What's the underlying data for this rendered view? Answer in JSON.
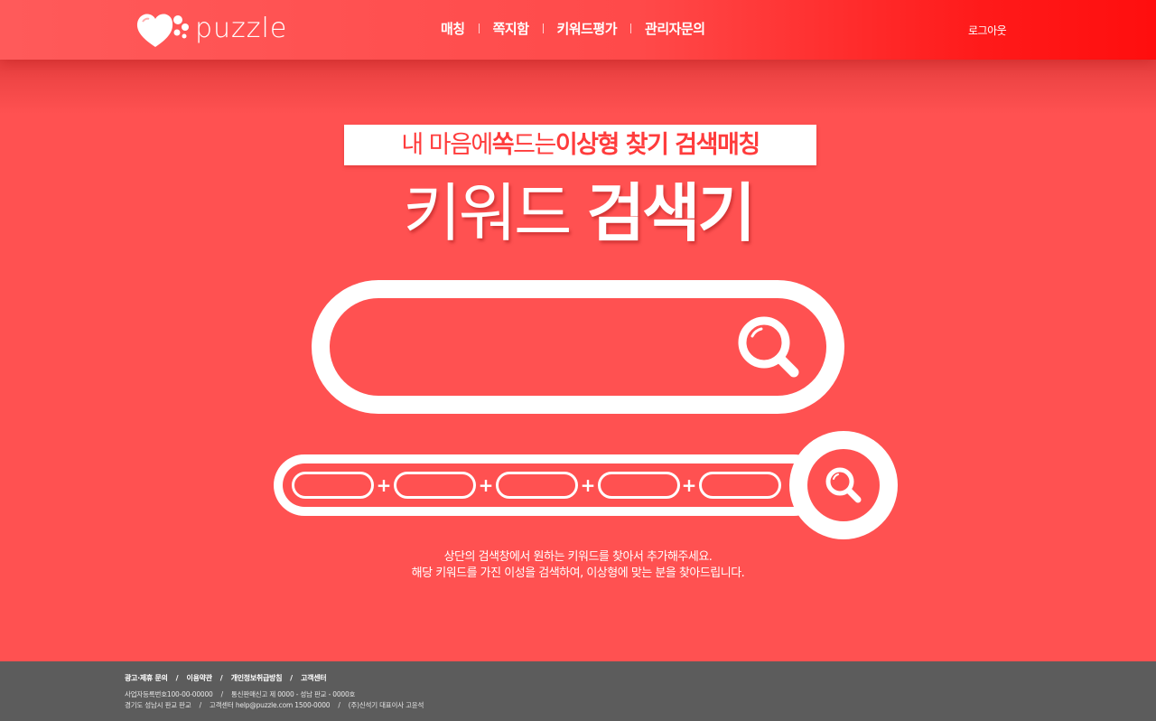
{
  "brand": {
    "name": "puzzle"
  },
  "nav": {
    "items": [
      {
        "label": "매칭"
      },
      {
        "label": "쪽지함"
      },
      {
        "label": "키워드평가"
      },
      {
        "label": "관리자문의"
      }
    ],
    "logout": "로그아웃"
  },
  "hero": {
    "tagline_part1": "내 마음에 ",
    "tagline_part2": "쏙",
    "tagline_part3": " 드는 ",
    "tagline_part4": "이상형 찾기 검색매칭",
    "title_thin": "키워드 ",
    "title_bold": "검색기"
  },
  "search": {
    "main_value": "",
    "main_placeholder": "",
    "keywords": [
      "",
      "",
      "",
      "",
      ""
    ],
    "plus": "+"
  },
  "description": {
    "line1": "상단의 검색창에서 원하는 키워드를 찾아서 추가해주세요.",
    "line2": "해당 키워드를 가진 이성을 검색하여, 이상형에 맞는 분을 찾아드립니다."
  },
  "footer": {
    "links": [
      "광고·제휴 문의",
      "이용약관",
      "개인정보취급방침",
      "고객센터"
    ],
    "separator": "/",
    "info_row1": [
      "사업자등록번호100-00-00000",
      "통신판매신고 제 0000 - 성남 판교 - 0000호"
    ],
    "info_row2": [
      "경기도 성남시 판교 판교",
      "고객센터 help@puzzle.com 1500-0000",
      "(주)신석기 대표이사 고윤석"
    ]
  },
  "colors": {
    "background": "#ff5151",
    "header_start": "#ff5a5a",
    "header_end": "#ff0e0e",
    "accent_text": "#ff3c3c",
    "footer": "#5c5c5c",
    "white": "#ffffff"
  }
}
